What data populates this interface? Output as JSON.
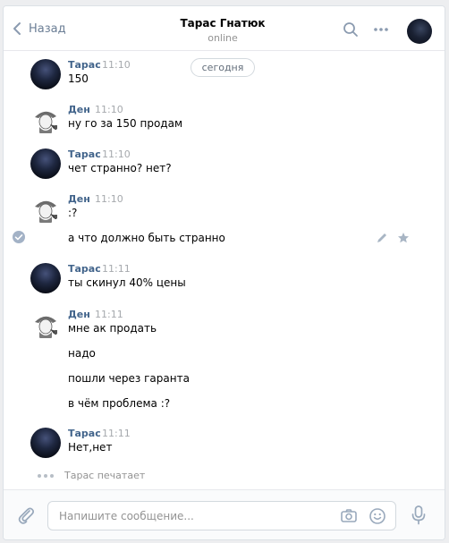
{
  "header": {
    "back_label": "Назад",
    "peer_name": "Тарас Гнатюк",
    "peer_status": "online"
  },
  "history": {
    "date_label": "сегодня",
    "messages": [
      {
        "author": "Тарас",
        "time": "11:10",
        "lines": [
          "150"
        ]
      },
      {
        "author": "Ден",
        "time": "11:10",
        "lines": [
          "ну го за 150 продам"
        ]
      },
      {
        "author": "Тарас",
        "time": "11:10",
        "lines": [
          "чет странно? нет?"
        ]
      },
      {
        "author": "Ден",
        "time": "11:10",
        "lines": [
          ":?",
          "а что должно быть странно"
        ]
      },
      {
        "author": "Тарас",
        "time": "11:11",
        "lines": [
          "ты скинул 40% цены"
        ]
      },
      {
        "author": "Ден",
        "time": "11:11",
        "lines": [
          "мне ак продать",
          "надо",
          "пошли через гаранта",
          "в чём проблема :?"
        ]
      },
      {
        "author": "Тарас",
        "time": "11:11",
        "lines": [
          "Нет,нет"
        ]
      }
    ],
    "typing": "Тарас печатает"
  },
  "composer": {
    "placeholder": "Напишите сообщение..."
  },
  "icons": {
    "back": "chevron-left-icon",
    "search": "search-icon",
    "more": "more-dots-icon",
    "attach": "paperclip-icon",
    "camera": "camera-icon",
    "emoji": "smile-icon",
    "mic": "microphone-icon",
    "edit": "pencil-icon",
    "favorite": "star-icon",
    "selected": "check-circle-icon"
  },
  "colors": {
    "link": "#42648b",
    "muted": "#939393",
    "border": "#d3d9de"
  }
}
